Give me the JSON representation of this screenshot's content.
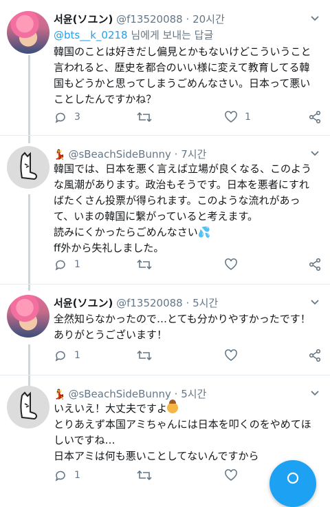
{
  "tweets": [
    {
      "name": "서윤(ソユン)",
      "handle": "@f13520088",
      "time": "20시간",
      "reply_link": "@bts__k_0218",
      "reply_suffix": " 님에게 보내는 답글",
      "lines": [
        "韓国のことは好きだし偏見とかもないけどこういうこと",
        "言われると、歴史を都合のいい様に変えて教育してる韓",
        "国もどうかと思ってしまうごめんなさい。日本って悪い",
        "ことしたんですかね？"
      ],
      "replies": "3",
      "retweets": "",
      "likes": "1"
    },
    {
      "name": "",
      "handle": "@sBeachSideBunny",
      "time": "7시간",
      "lines": [
        "韓国では、日本を悪く言えば立場が良くなる、このよう",
        "な風潮があります。政治もそうです。日本を悪者にすれ",
        "ばたくさん投票が得られます。このような流れがあっ",
        "て、いまの韓国に繋がっていると考えます。",
        "読みにくかったらごめんなさい",
        "ff外から失礼しました。"
      ],
      "line5_emoji": "💦",
      "replies": "1",
      "retweets": "",
      "likes": ""
    },
    {
      "name": "서윤(ソユン)",
      "handle": "@f13520088",
      "time": "5시간",
      "lines": [
        "全然知らなかったので…とても分かりやすかったです！",
        "ありがとうございます！"
      ],
      "replies": "1",
      "retweets": "",
      "likes": ""
    },
    {
      "name": "",
      "handle": "@sBeachSideBunny",
      "time": "5시간",
      "lines": [
        "いえいえ！大丈夫ですよ",
        "とりあえず本国アミちゃんには日本を叩くのをやめてほ",
        "しいですね…",
        "日本アミは何も悪いことしてないんですから"
      ],
      "replies": "1",
      "retweets": "",
      "likes": ""
    }
  ],
  "colors": {
    "accent": "#1da1f2",
    "muted": "#657786",
    "text": "#14171a",
    "line": "#ccd6dd"
  },
  "icons": [
    "reply-icon",
    "retweet-icon",
    "like-icon",
    "share-icon",
    "chevron-down-icon",
    "compose-icon",
    "dancer-emoji-icon"
  ]
}
